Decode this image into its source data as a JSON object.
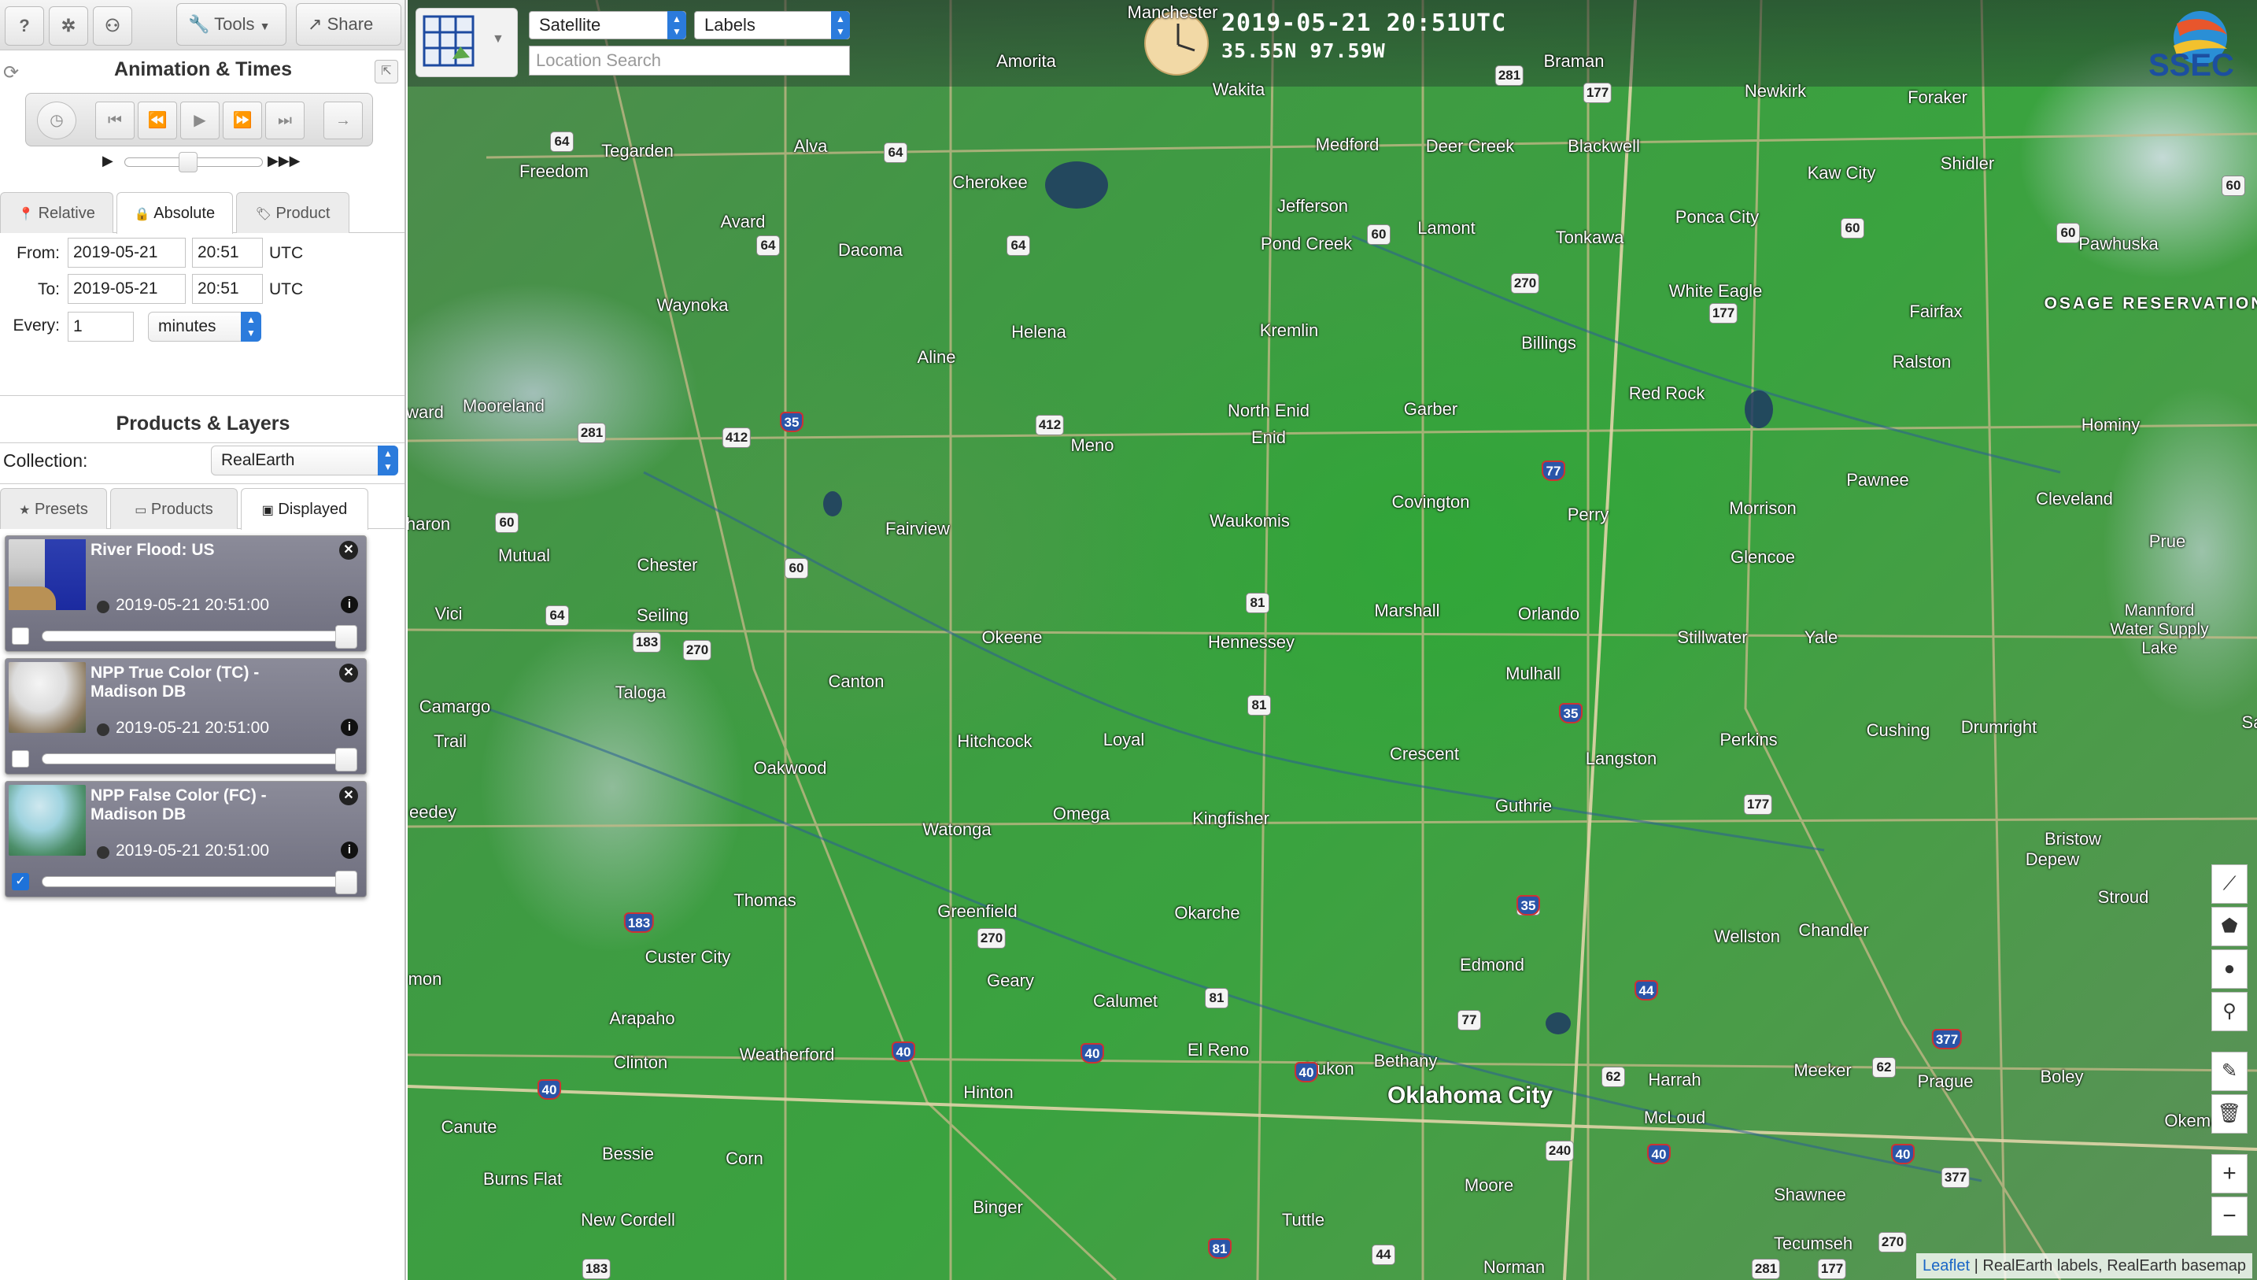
{
  "toolbar": {
    "help_label": "?",
    "tools_label": "Tools",
    "share_label": "Share"
  },
  "animation": {
    "title": "Animation & Times",
    "tabs": [
      "Relative",
      "Absolute",
      "Product"
    ],
    "active_tab": "Absolute",
    "from_label": "From:",
    "from_date": "2019-05-21",
    "from_time": "20:51",
    "to_label": "To:",
    "to_date": "2019-05-21",
    "to_time": "20:51",
    "tz": "UTC",
    "every_label": "Every:",
    "every_value": "1",
    "every_unit": "minutes"
  },
  "products": {
    "title": "Products & Layers",
    "collection_label": "Collection:",
    "collection_value": "RealEarth",
    "tabs": [
      "Presets",
      "Products",
      "Displayed"
    ],
    "active_tab": "Displayed",
    "layers": [
      {
        "title": "River Flood: US",
        "time": "2019-05-21 20:51:00",
        "checked": false
      },
      {
        "title": "NPP True Color (TC) - Madison DB",
        "time": "2019-05-21 20:51:00",
        "checked": false
      },
      {
        "title": "NPP False Color (FC) - Madison DB",
        "time": "2019-05-21 20:51:00",
        "checked": true
      }
    ]
  },
  "map": {
    "basemap_select": "Satellite",
    "labels_select": "Labels",
    "search_placeholder": "Location Search",
    "datetime": "2019-05-21 20:51UTC",
    "coords": "35.55N 97.59W",
    "logo_text": "SSEC",
    "attribution_link": "Leaflet",
    "attribution_text": " | RealEarth labels, RealEarth basemap",
    "places": [
      "Amorita",
      "Wakita",
      "Braman",
      "Newkirk",
      "Foraker",
      "Tegarden",
      "Alva",
      "Medford",
      "Deer Creek",
      "Blackwell",
      "Freedom",
      "Cherokee",
      "Kaw City",
      "Shidler",
      "Jefferson",
      "Avard",
      "Dacoma",
      "Pond Creek",
      "Lamont",
      "Tonkawa",
      "Ponca City",
      "Pawhuska",
      "Waynoka",
      "White Eagle",
      "Fairfax",
      "Aline",
      "Helena",
      "Kremlin",
      "Billings",
      "Ralston",
      "Mooreland",
      "Red Rock",
      "North Enid",
      "Enid",
      "Garber",
      "Hominy",
      "Meno",
      "Pawnee",
      "Waukomis",
      "Covington",
      "Perry",
      "Morrison",
      "Cleveland",
      "Mutual",
      "Chester",
      "Fairview",
      "Glencoe",
      "Prue",
      "Vici",
      "Seiling",
      "Marshall",
      "Orlando",
      "Okeene",
      "Hennessey",
      "Stillwater",
      "Yale",
      "Mulhall",
      "Taloga",
      "Canton",
      "Camargo",
      "Trail",
      "Cushing",
      "Drumright",
      "Oakwood",
      "Hitchcock",
      "Loyal",
      "Crescent",
      "Langston",
      "Perkins",
      "Watonga",
      "Omega",
      "Kingfisher",
      "Guthrie",
      "Bristow",
      "Depew",
      "Thomas",
      "Greenfield",
      "Okarche",
      "Stroud",
      "Chandler",
      "Wellston",
      "Custer City",
      "Geary",
      "Calumet",
      "Edmond",
      "Arapaho",
      "Clinton",
      "Weatherford",
      "El Reno",
      "Yukon",
      "Bethany",
      "Harrah",
      "Meeker",
      "Prague",
      "Boley",
      "Hinton",
      "Canute",
      "McLoud",
      "Okemah",
      "Bessie",
      "Corn",
      "Burns Flat",
      "Moore",
      "Shawnee",
      "New Cordell",
      "Binger",
      "Tuttle",
      "Tecumseh",
      "Norman",
      "Manchester"
    ],
    "big_place": "Oklahoma City",
    "region_label": "OSAGE RESERVATION",
    "water_label": "Mannford Water Supply Lake",
    "edge_labels": [
      "ward",
      "haron",
      "eedey",
      "mon",
      "Sa"
    ],
    "shields": [
      "64",
      "64",
      "281",
      "64",
      "64",
      "60",
      "60",
      "60",
      "60",
      "177",
      "177",
      "412",
      "281",
      "412",
      "412",
      "35",
      "270",
      "77",
      "60",
      "60",
      "81",
      "183",
      "270",
      "64",
      "81",
      "35",
      "177",
      "183",
      "270",
      "35",
      "81",
      "44",
      "77",
      "40",
      "40",
      "40",
      "40",
      "62",
      "62",
      "240",
      "40",
      "40",
      "377",
      "377",
      "44",
      "81",
      "183",
      "270",
      "177",
      "35",
      "281"
    ]
  },
  "map_tools": [
    "polyline-icon",
    "polygon-icon",
    "circle-icon",
    "marker-icon",
    "edit-icon",
    "trash-icon"
  ],
  "zoom": {
    "in": "+",
    "out": "−"
  }
}
